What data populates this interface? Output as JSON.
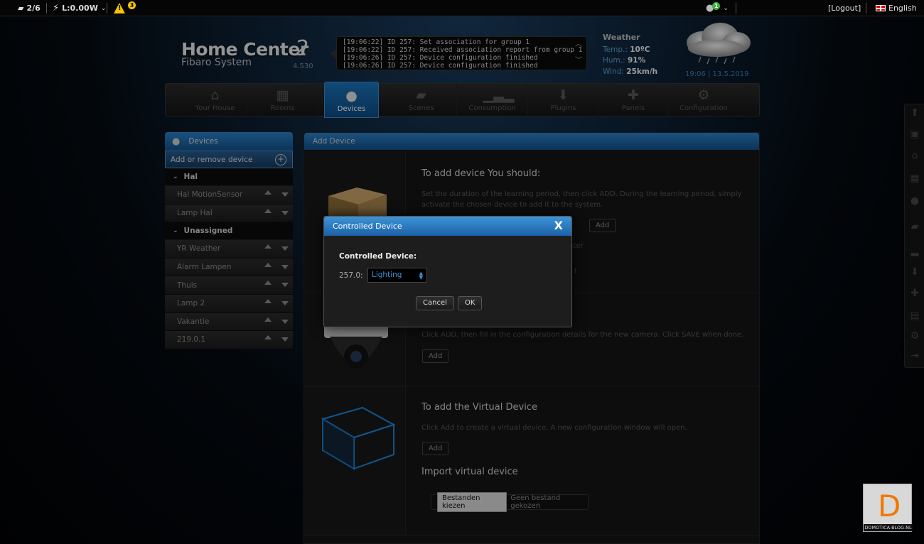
{
  "topbar": {
    "devices_count": "2/6",
    "power": "L:0.00W",
    "warnings_count": "3",
    "users_count": "1",
    "logout": "[Logout]",
    "language": "English"
  },
  "logo": {
    "main": "Home Center",
    "number": "2",
    "sub": "Fibaro System",
    "version": "4.530"
  },
  "event_log": [
    "[19:06:22] ID 257: Set association for group 1",
    "[19:06:22] ID 257: Received association report from group 1",
    "[19:06:26] ID 257: Device configuration finished",
    "[19:06:26] ID 257: Device configuration finished"
  ],
  "weather": {
    "title": "Weather",
    "temp_label": "Temp.:",
    "temp_value": "10ºC",
    "hum_label": "Hum.:",
    "hum_value": "91%",
    "wind_label": "Wind:",
    "wind_value": "25km/h",
    "datetime": "19:06 | 13.5.2019",
    "icon": "rain-cloud-icon"
  },
  "nav": {
    "items": [
      {
        "label": "Your House",
        "icon": "house-icon"
      },
      {
        "label": "Rooms",
        "icon": "rooms-icon"
      },
      {
        "label": "Devices",
        "icon": "bulb-icon"
      },
      {
        "label": "Scenes",
        "icon": "clapper-icon"
      },
      {
        "label": "Consumption",
        "icon": "chart-icon"
      },
      {
        "label": "Plugins",
        "icon": "download-box-icon"
      },
      {
        "label": "Panels",
        "icon": "puzzle-icon"
      },
      {
        "label": "Configuration",
        "icon": "gears-icon"
      }
    ],
    "active": "Devices"
  },
  "sidebar": {
    "title": "Devices",
    "add_remove": "Add or remove device",
    "groups": [
      {
        "name": "Hal",
        "devices": [
          "Hal MotionSensor",
          "Lamp Hal"
        ]
      },
      {
        "name": "Unassigned",
        "devices": [
          "YR Weather",
          "Alarm Lampen",
          "Thuis",
          "Lamp 2",
          "Vakantie",
          "219.0.1"
        ]
      }
    ]
  },
  "panel": {
    "title": "Add Device",
    "section1": {
      "heading": "To add device You should:",
      "text": "Set the duration of the learning period, then click ADD. During the learning period, simply activate the chosen device to add it to the system.",
      "add_label": "Add",
      "peek1": "nter",
      "peek2": "t"
    },
    "section2": {
      "text": "Click ADD, then fill in the configuration details for the new camera. Click SAVE when done.",
      "add_label": "Add"
    },
    "section3": {
      "heading": "To add the Virtual Device",
      "text": "Click Add to create a virtual device. A new configuration window will open.",
      "add_label": "Add",
      "import_heading": "Import virtual device",
      "file_button": "Bestanden kiezen",
      "file_none": "Geen bestand gekozen"
    }
  },
  "modal": {
    "title": "Controlled Device",
    "close": "X",
    "label": "Controlled Device:",
    "node": "257.0:",
    "selected": "Lighting",
    "cancel": "Cancel",
    "ok": "OK"
  },
  "watermark": {
    "letter": "D",
    "text": "DOMOTICA-BLOG.NL"
  },
  "colors": {
    "accent": "#1c62a8",
    "select_text": "#3a94e0",
    "warning": "#f5c400"
  }
}
